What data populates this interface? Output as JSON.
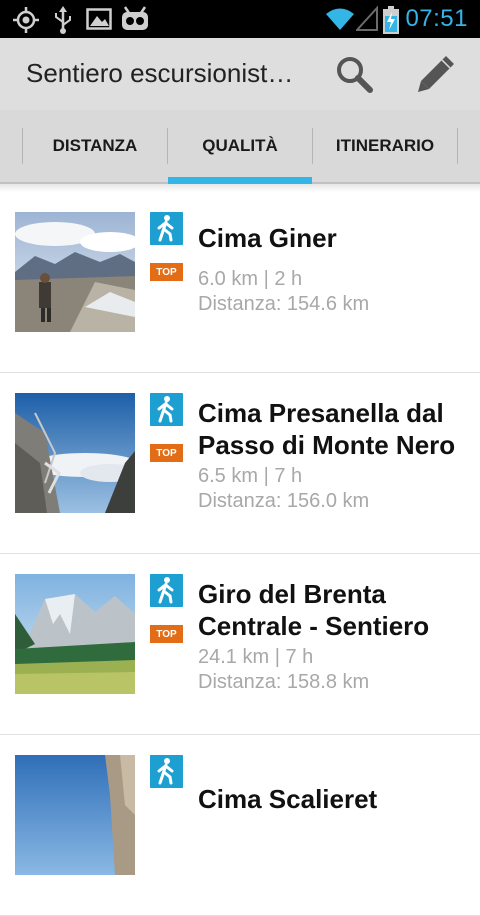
{
  "status_bar": {
    "time": "07:51",
    "icons": [
      "gps-icon",
      "usb-icon",
      "picture-icon",
      "android-mascot-icon",
      "wifi-icon",
      "signal-icon",
      "battery-charging-icon"
    ]
  },
  "action_bar": {
    "title": "Sentiero escursionist…",
    "actions": [
      "search-icon",
      "pencil-icon"
    ]
  },
  "tabs": {
    "items": [
      {
        "label": "DISTANZA",
        "selected": false
      },
      {
        "label": "QUALITÀ",
        "selected": true
      },
      {
        "label": "ITINERARIO",
        "selected": false
      }
    ],
    "accent": "#33b5e5"
  },
  "routes": [
    {
      "title": "Cima Giner",
      "length_time": "6.0 km | 2 h",
      "distance": "Distanza:  154.6 km",
      "type_icon": "hiking-icon",
      "badge": "TOP"
    },
    {
      "title": "Cima Presanella dal Passo di Monte Nero",
      "length_time": "6.5 km | 7 h",
      "distance": "Distanza:  156.0 km",
      "type_icon": "hiking-icon",
      "badge": "TOP"
    },
    {
      "title": "Giro del Brenta Centrale - Sentiero",
      "length_time": "24.1 km | 7 h",
      "distance": "Distanza:  158.8 km",
      "type_icon": "hiking-icon",
      "badge": "TOP"
    },
    {
      "title": "Cima Scalieret",
      "length_time": "",
      "distance": "",
      "type_icon": "hiking-icon",
      "badge": ""
    }
  ],
  "colors": {
    "accent": "#33b5e5",
    "walk_badge": "#1d9fd1",
    "top_badge": "#e36c16",
    "meta_text": "#a8a8a8"
  }
}
